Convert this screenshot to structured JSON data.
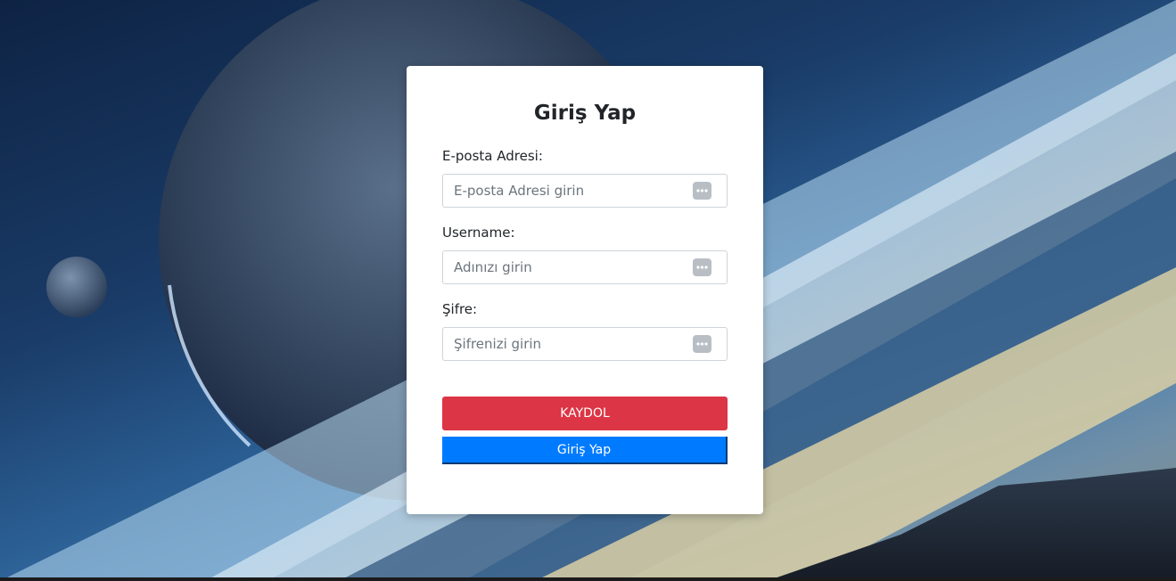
{
  "form": {
    "title": "Giriş Yap",
    "email": {
      "label": "E-posta Adresi:",
      "placeholder": "E-posta Adresi girin"
    },
    "username": {
      "label": "Username:",
      "placeholder": "Adınızı girin"
    },
    "password": {
      "label": "Şifre:",
      "placeholder": "Şifrenizi girin"
    },
    "register_button": "KAYDOL",
    "login_button": "Giriş Yap"
  },
  "colors": {
    "register_button": "#dc3545",
    "login_button": "#007bff",
    "card_background": "#ffffff"
  },
  "icons": {
    "field_icon": "password-manager-icon"
  }
}
